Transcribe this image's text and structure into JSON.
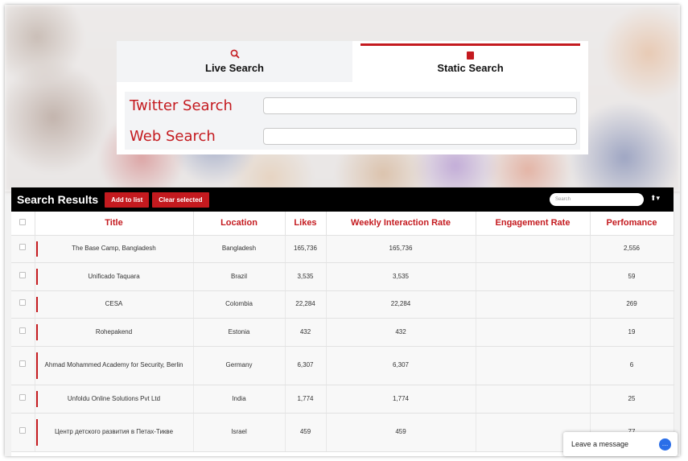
{
  "tabs": [
    {
      "label": "Live Search",
      "icon": "search-icon"
    },
    {
      "label": "Static Search",
      "icon": "book-icon"
    }
  ],
  "search_fields": [
    {
      "label": "Twitter Search",
      "value": ""
    },
    {
      "label": "Web Search",
      "value": ""
    }
  ],
  "results": {
    "title": "Search Results",
    "add_to_list": "Add to list",
    "clear_selected": "Clear selected",
    "search_placeholder": "Search",
    "columns": [
      "Title",
      "Location",
      "Likes",
      "Weekly Interaction Rate",
      "Engagement Rate",
      "Perfomance"
    ],
    "rows": [
      {
        "title": "The Base Camp, Bangladesh",
        "location": "Bangladesh",
        "likes": "165,736",
        "weekly": "165,736",
        "engagement": "",
        "performance": "2,556"
      },
      {
        "title": "Unificado Taquara",
        "location": "Brazil",
        "likes": "3,535",
        "weekly": "3,535",
        "engagement": "",
        "performance": "59"
      },
      {
        "title": "CESA",
        "location": "Colombia",
        "likes": "22,284",
        "weekly": "22,284",
        "engagement": "",
        "performance": "269"
      },
      {
        "title": "Rohepakend",
        "location": "Estonia",
        "likes": "432",
        "weekly": "432",
        "engagement": "",
        "performance": "19"
      },
      {
        "title": "Ahmad Mohammed Academy for Security, Berlin",
        "location": "Germany",
        "likes": "6,307",
        "weekly": "6,307",
        "engagement": "",
        "performance": "6"
      },
      {
        "title": "Unfoldu Online Solutions Pvt Ltd",
        "location": "India",
        "likes": "1,774",
        "weekly": "1,774",
        "engagement": "",
        "performance": "25"
      },
      {
        "title": "Центр детского развития в Петах-Тикве",
        "location": "Israel",
        "likes": "459",
        "weekly": "459",
        "engagement": "",
        "performance": "77"
      }
    ]
  },
  "chat": {
    "label": "Leave a message"
  },
  "colors": {
    "accent": "#c41a1f",
    "bar": "#000000",
    "chat": "#2a6ee8"
  }
}
